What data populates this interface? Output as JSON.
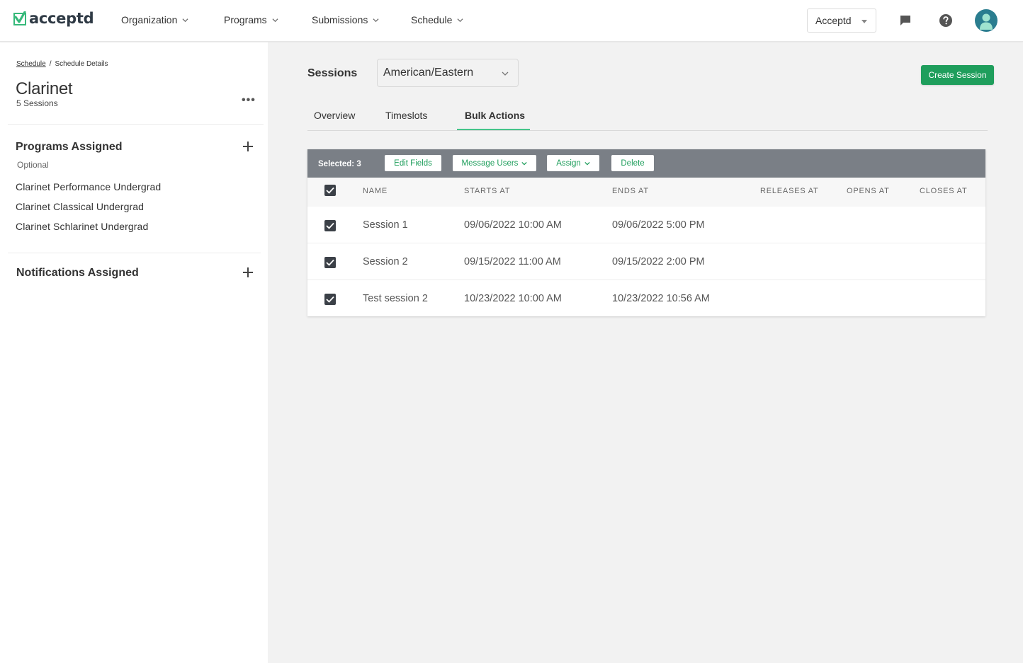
{
  "brand": {
    "name": "acceptd",
    "accent": "#1f9e5c",
    "logo_green": "#36b97a"
  },
  "nav": {
    "items": [
      {
        "label": "Organization"
      },
      {
        "label": "Programs"
      },
      {
        "label": "Submissions"
      },
      {
        "label": "Schedule"
      }
    ],
    "org_select": "Acceptd",
    "icons": [
      "chat-icon",
      "help-icon",
      "avatar"
    ]
  },
  "sidebar": {
    "breadcrumb": {
      "parent": "Schedule",
      "separator": "/",
      "current": "Schedule Details"
    },
    "title": "Clarinet",
    "subtitle": "5 Sessions",
    "more": "•••",
    "programs": {
      "title": "Programs Assigned",
      "note": "Optional",
      "items": [
        "Clarinet Performance Undergrad",
        "Clarinet Classical Undergrad",
        "Clarinet Schlarinet Undergrad"
      ]
    },
    "notifications": {
      "title": "Notifications Assigned"
    }
  },
  "main": {
    "sessions_label": "Sessions",
    "timezone": "American/Eastern",
    "create_button": "Create Session",
    "tabs": [
      {
        "label": "Overview",
        "active": false
      },
      {
        "label": "Timeslots",
        "active": false
      },
      {
        "label": "Bulk Actions",
        "active": true
      }
    ],
    "bulk": {
      "selected": "Selected: 3",
      "edit_fields": "Edit Fields",
      "message_users": "Message Users",
      "assign": "Assign",
      "delete": "Delete"
    },
    "table": {
      "columns": [
        "NAME",
        "STARTS AT",
        "ENDS AT",
        "RELEASES AT",
        "OPENS AT",
        "CLOSES AT"
      ],
      "rows": [
        {
          "checked": true,
          "name": "Session 1",
          "starts": "09/06/2022 10:00 AM",
          "ends": "09/06/2022 5:00 PM",
          "releases": "",
          "opens": "",
          "closes": ""
        },
        {
          "checked": true,
          "name": "Session 2",
          "starts": "09/15/2022 11:00 AM",
          "ends": "09/15/2022 2:00 PM",
          "releases": "",
          "opens": "",
          "closes": ""
        },
        {
          "checked": true,
          "name": "Test session 2",
          "starts": "10/23/2022 10:00 AM",
          "ends": "10/23/2022 10:56 AM",
          "releases": "",
          "opens": "",
          "closes": ""
        }
      ]
    }
  }
}
